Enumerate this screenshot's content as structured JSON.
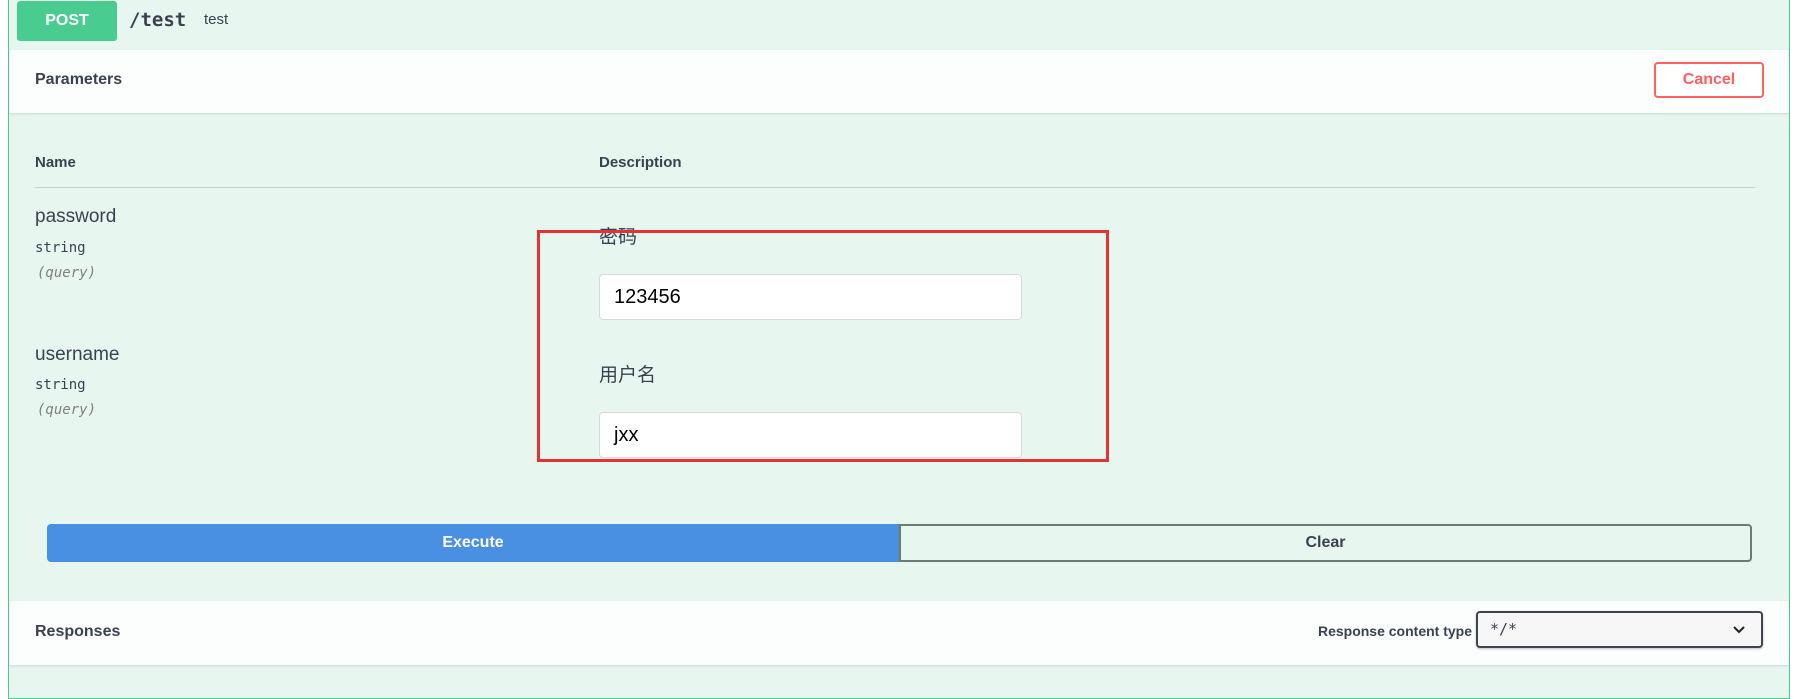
{
  "operation": {
    "method": "POST",
    "path": "/test",
    "summary": "test"
  },
  "parameters_section": {
    "title": "Parameters",
    "cancel_label": "Cancel",
    "columns": {
      "name": "Name",
      "description": "Description"
    },
    "params": [
      {
        "name": "password",
        "type": "string",
        "in": "(query)",
        "description": "密码",
        "value": "123456"
      },
      {
        "name": "username",
        "type": "string",
        "in": "(query)",
        "description": "用户名",
        "value": "jxx"
      }
    ]
  },
  "actions": {
    "execute_label": "Execute",
    "clear_label": "Clear"
  },
  "responses_section": {
    "title": "Responses",
    "content_type_label": "Response content type",
    "content_type_value": "*/*"
  },
  "colors": {
    "post": "#49cc90",
    "execute": "#4990e2",
    "cancel": "#ff6060",
    "highlight": "#e53333"
  }
}
